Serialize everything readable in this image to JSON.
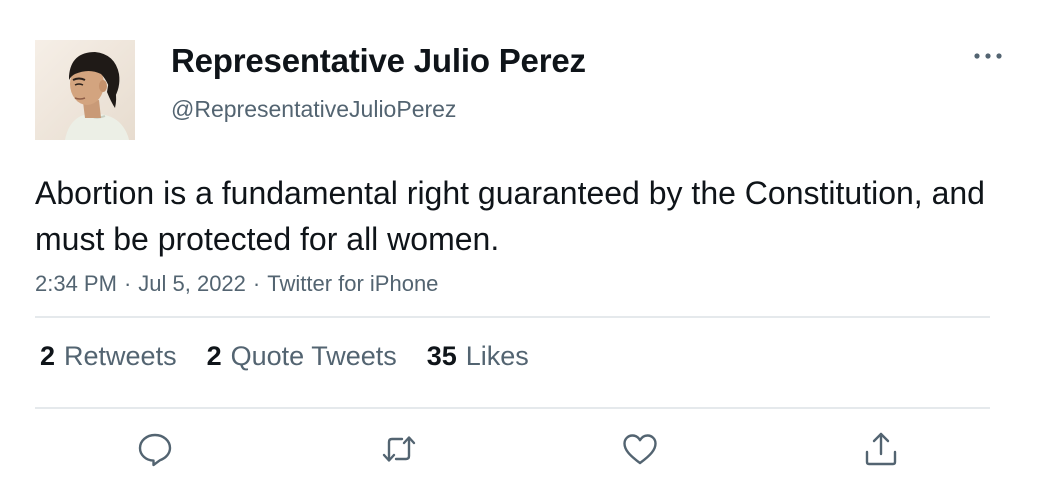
{
  "tweet": {
    "author_name": "Representative Julio Perez",
    "author_handle": "@RepresentativeJulioPerez",
    "text": "Abortion is a fundamental right guaranteed by the Constitution, and must be protected for all women.",
    "time": "2:34 PM",
    "date": "Jul 5, 2022",
    "source": "Twitter for iPhone",
    "separator": "·"
  },
  "stats": {
    "retweets_count": "2",
    "retweets_label": "Retweets",
    "quote_tweets_count": "2",
    "quote_tweets_label": "Quote Tweets",
    "likes_count": "35",
    "likes_label": "Likes"
  },
  "icons": {
    "more": "more-horizontal-icon",
    "reply": "reply-icon",
    "retweet": "retweet-icon",
    "like": "heart-icon",
    "share": "share-icon"
  },
  "colors": {
    "text_primary": "#0f1419",
    "text_secondary": "#536471",
    "divider": "#e5e9ec",
    "icon": "#536471"
  }
}
